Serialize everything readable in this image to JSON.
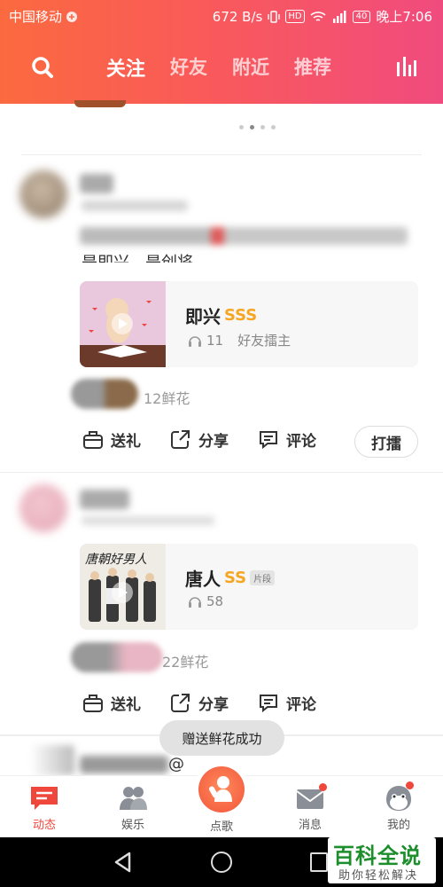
{
  "status_bar": {
    "carrier": "中国移动",
    "speed": "672 B/s",
    "hd_badge": "HD",
    "network": "4G",
    "battery": "40",
    "time": "晚上7:06"
  },
  "header": {
    "tabs": [
      {
        "label": "关注",
        "active": true
      },
      {
        "label": "好友",
        "active": false
      },
      {
        "label": "附近",
        "active": false
      },
      {
        "label": "推荐",
        "active": false
      }
    ],
    "gradient": [
      "#fb6a3f",
      "#f04b7e"
    ]
  },
  "carousel": {
    "pages": 4,
    "current": 1
  },
  "posts": [
    {
      "caption_partial": "是即兴，是创将。",
      "song": {
        "title": "即兴",
        "rank": "SSS",
        "listens": "11",
        "extra": "好友擂主"
      },
      "flowers": "12鲜花",
      "actions": {
        "gift": "送礼",
        "share": "分享",
        "comment": "评论",
        "play": "打擂"
      }
    },
    {
      "song": {
        "title": "唐人",
        "rank": "SS",
        "tag": "片段",
        "listens": "58"
      },
      "flowers": "22鲜花",
      "actions": {
        "gift": "送礼",
        "share": "分享",
        "comment": "评论"
      }
    }
  ],
  "partial_next_post": "@",
  "toast": "赠送鲜花成功",
  "tabbar": {
    "items": [
      {
        "label": "动态",
        "icon": "feed-icon",
        "active": true
      },
      {
        "label": "娱乐",
        "icon": "friends-icon",
        "active": false
      },
      {
        "label": "点歌",
        "icon": "sing-icon",
        "active": false
      },
      {
        "label": "消息",
        "icon": "mail-icon",
        "active": false
      },
      {
        "label": "我的",
        "icon": "profile-icon",
        "active": false
      }
    ],
    "accent": "#f0473c"
  },
  "watermark": {
    "title": "百科全说",
    "subtitle": "助你轻松解决"
  }
}
